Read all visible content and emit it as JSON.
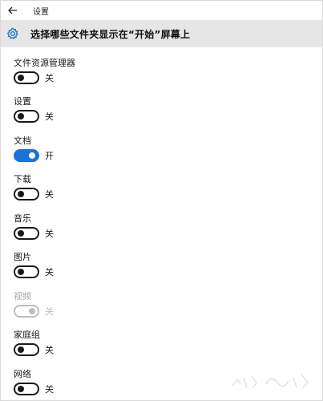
{
  "window": {
    "title": "设置"
  },
  "header": {
    "title": "选择哪些文件夹显示在“开始”屏幕上"
  },
  "settings": [
    {
      "label": "文件资源管理器",
      "state": "关",
      "on": false,
      "disabled": false
    },
    {
      "label": "设置",
      "state": "关",
      "on": false,
      "disabled": false
    },
    {
      "label": "文档",
      "state": "开",
      "on": true,
      "disabled": false
    },
    {
      "label": "下载",
      "state": "关",
      "on": false,
      "disabled": false
    },
    {
      "label": "音乐",
      "state": "关",
      "on": false,
      "disabled": false
    },
    {
      "label": "图片",
      "state": "关",
      "on": false,
      "disabled": false
    },
    {
      "label": "视频",
      "state": "关",
      "on": false,
      "disabled": true
    },
    {
      "label": "家庭组",
      "state": "关",
      "on": false,
      "disabled": false
    },
    {
      "label": "网络",
      "state": "关",
      "on": false,
      "disabled": false
    }
  ],
  "colors": {
    "accent": "#1a73d8",
    "header_bg": "#e6e6e6",
    "disabled": "#bdbdbd"
  },
  "icons": {
    "back": "arrow-left-icon",
    "settings": "gear-icon"
  }
}
